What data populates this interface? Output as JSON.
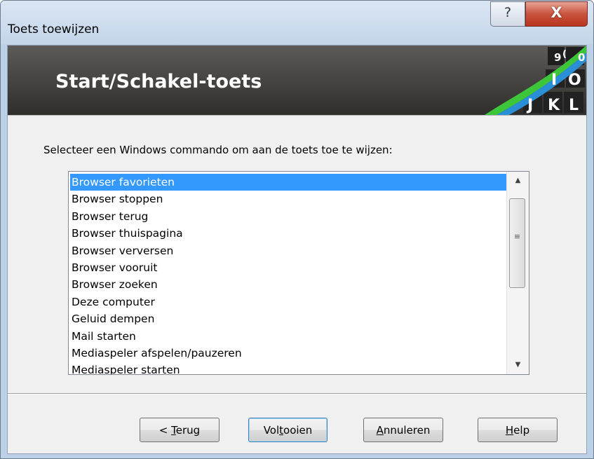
{
  "window": {
    "title": "Toets toewijzen",
    "help_glyph": "?",
    "close_glyph": "X"
  },
  "banner": {
    "title": "Start/Schakel-toets",
    "logo_keys": [
      "9",
      "(",
      "0",
      "I",
      "O",
      "J",
      "K",
      "L"
    ]
  },
  "main": {
    "prompt": "Selecteer een Windows commando om aan de toets toe te wijzen:",
    "list": {
      "selected_index": 0,
      "items": [
        "Browser favorieten",
        "Browser stoppen",
        "Browser terug",
        "Browser thuispagina",
        "Browser verversen",
        "Browser vooruit",
        "Browser zoeken",
        "Deze computer",
        "Geluid dempen",
        "Mail starten",
        "Mediaspeler afspelen/pauzeren",
        "Mediaspeler starten"
      ]
    }
  },
  "footer": {
    "buttons": {
      "back": {
        "label_pre": "< ",
        "label_ul": "T",
        "label_post": "erug"
      },
      "finish": {
        "label_pre": "Vol",
        "label_ul": "t",
        "label_post": "ooien"
      },
      "cancel": {
        "label_pre": "",
        "label_ul": "A",
        "label_post": "nnuleren"
      },
      "help": {
        "label_pre": "",
        "label_ul": "H",
        "label_post": "elp"
      }
    }
  },
  "colors": {
    "selection": "#3399ff",
    "close_button": "#c8533e",
    "banner_bg": "#3f3e3c",
    "logo_green": "#3ec63a",
    "logo_blue": "#2a8fd6"
  }
}
